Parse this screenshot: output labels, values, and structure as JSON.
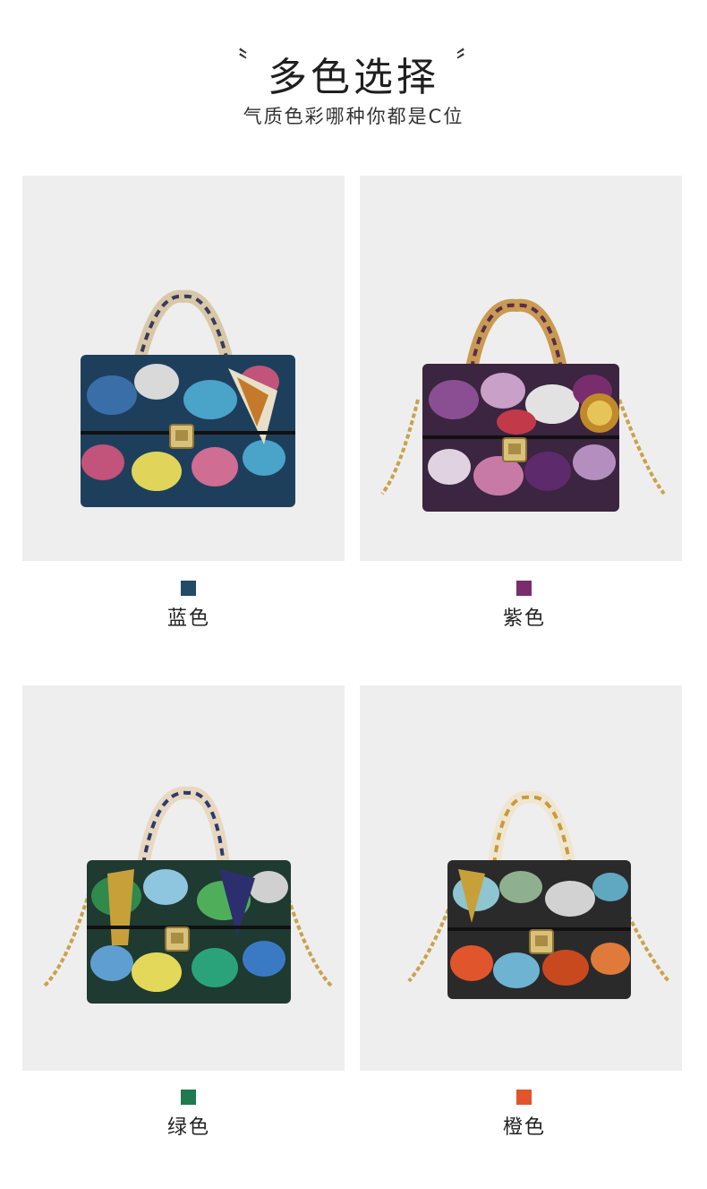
{
  "header": {
    "quote_open": "〝",
    "title": "多色选择",
    "quote_close": "〞",
    "subtitle": "气质色彩哪种你都是C位"
  },
  "variants": [
    {
      "label": "蓝色",
      "color": "#234a66",
      "icon": "blue-snakeskin-handbag"
    },
    {
      "label": "紫色",
      "color": "#7a2d6e",
      "icon": "purple-snakeskin-handbag"
    },
    {
      "label": "绿色",
      "color": "#1f7a4f",
      "icon": "green-snakeskin-handbag"
    },
    {
      "label": "橙色",
      "color": "#e0552b",
      "icon": "orange-snakeskin-handbag"
    }
  ]
}
